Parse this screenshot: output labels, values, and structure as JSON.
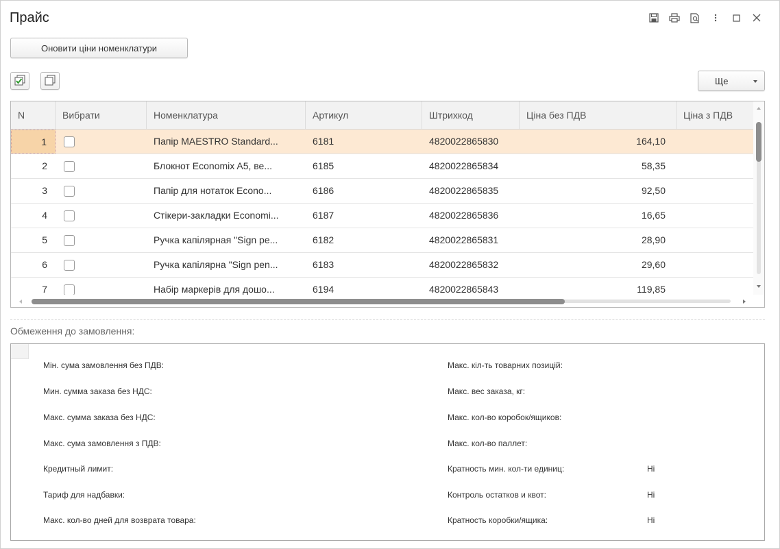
{
  "window": {
    "title": "Прайс"
  },
  "toolbar": {
    "refresh_label": "Оновити ціни номенклатури",
    "more_label": "Ще"
  },
  "table": {
    "columns": [
      "N",
      "Вибрати",
      "Номенклатура",
      "Артикул",
      "Штрихкод",
      "Ціна без ПДВ",
      "Ціна з ПДВ"
    ],
    "rows": [
      {
        "n": "1",
        "name": "Папір MAESTRO Standard...",
        "article": "6181",
        "barcode": "4820022865830",
        "price": "164,10",
        "price_vat": ""
      },
      {
        "n": "2",
        "name": "Блокнот Economix A5, ве...",
        "article": "6185",
        "barcode": "4820022865834",
        "price": "58,35",
        "price_vat": ""
      },
      {
        "n": "3",
        "name": "Папір для нотаток Econo...",
        "article": "6186",
        "barcode": "4820022865835",
        "price": "92,50",
        "price_vat": ""
      },
      {
        "n": "4",
        "name": "Стікери-закладки Economi...",
        "article": "6187",
        "barcode": "4820022865836",
        "price": "16,65",
        "price_vat": ""
      },
      {
        "n": "5",
        "name": "Ручка капілярная \"Sign pe...",
        "article": "6182",
        "barcode": "4820022865831",
        "price": "28,90",
        "price_vat": ""
      },
      {
        "n": "6",
        "name": "Ручка капілярна \"Sign pen...",
        "article": "6183",
        "barcode": "4820022865832",
        "price": "29,60",
        "price_vat": ""
      },
      {
        "n": "7",
        "name": "Набір маркерів для дошо...",
        "article": "6194",
        "barcode": "4820022865843",
        "price": "119,85",
        "price_vat": ""
      }
    ]
  },
  "limits": {
    "section_label": "Обмеження до замовлення:",
    "left": [
      {
        "label": "Мін. сума замовлення без ПДВ:",
        "value": ""
      },
      {
        "label": "Мин. сумма заказа без НДС:",
        "value": ""
      },
      {
        "label": "Макс. сумма заказа без НДС:",
        "value": ""
      },
      {
        "label": "Макс. сума замовлення з ПДВ:",
        "value": ""
      },
      {
        "label": "Кредитный лимит:",
        "value": ""
      },
      {
        "label": "Тариф для надбавки:",
        "value": ""
      },
      {
        "label": "Макс. кол-во дней для возврата товара:",
        "value": ""
      }
    ],
    "right": [
      {
        "label": "Макс. кіл-ть товарних позицій:",
        "value": ""
      },
      {
        "label": "Макс. вес заказа, кг:",
        "value": ""
      },
      {
        "label": "Макс. кол-во коробок/ящиков:",
        "value": ""
      },
      {
        "label": "Макс. кол-во паллет:",
        "value": ""
      },
      {
        "label": "Кратность мин. кол-ти единиц:",
        "value": "Ні"
      },
      {
        "label": "Контроль остатков и квот:",
        "value": "Ні"
      },
      {
        "label": "Кратность коробки/ящика:",
        "value": "Ні"
      }
    ]
  },
  "icons": {
    "window": [
      "save-icon",
      "print-icon",
      "preview-icon",
      "more-vertical-icon",
      "maximize-icon",
      "close-icon"
    ],
    "table_toolbar": [
      "check-all-icon",
      "uncheck-all-icon"
    ]
  },
  "colors": {
    "selected_row": "#fde9d3",
    "selected_cell": "#f7d4a8",
    "header_bg": "#f2f2f2"
  }
}
